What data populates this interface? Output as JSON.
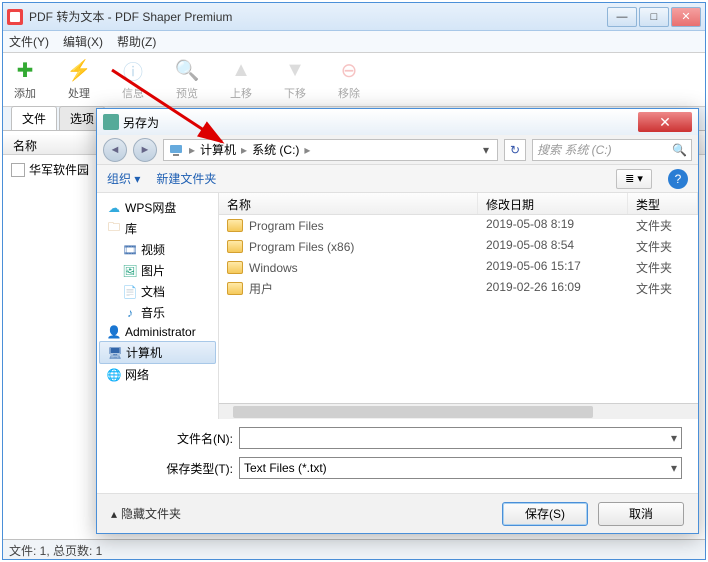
{
  "main": {
    "title": "PDF 转为文本 - PDF Shaper Premium",
    "menu": {
      "file": "文件(Y)",
      "edit": "编辑(X)",
      "help": "帮助(Z)"
    },
    "tools": {
      "add": "添加",
      "process": "处理",
      "info": "信息",
      "preview": "预览",
      "up": "上移",
      "down": "下移",
      "remove": "移除"
    },
    "tabs": {
      "files": "文件",
      "options": "选项"
    },
    "list_header": "名称",
    "list_item": "华军软件园",
    "status": "文件: 1, 总页数: 1"
  },
  "dialog": {
    "title": "另存为",
    "breadcrumb": {
      "computer": "计算机",
      "drive": "系统 (C:)"
    },
    "search_placeholder": "搜索 系统 (C:)",
    "toolbar": {
      "organize": "组织",
      "newfolder": "新建文件夹"
    },
    "tree": {
      "wps": "WPS网盘",
      "lib": "库",
      "video": "视频",
      "pic": "图片",
      "doc": "文档",
      "music": "音乐",
      "admin": "Administrator",
      "computer": "计算机",
      "network": "网络"
    },
    "cols": {
      "name": "名称",
      "date": "修改日期",
      "type": "类型"
    },
    "rows": [
      {
        "name": "Program Files",
        "date": "2019-05-08 8:19",
        "type": "文件夹"
      },
      {
        "name": "Program Files (x86)",
        "date": "2019-05-08 8:54",
        "type": "文件夹"
      },
      {
        "name": "Windows",
        "date": "2019-05-06 15:17",
        "type": "文件夹"
      },
      {
        "name": "用户",
        "date": "2019-02-26 16:09",
        "type": "文件夹"
      }
    ],
    "form": {
      "filename_label": "文件名(N):",
      "filename_value": "",
      "type_label": "保存类型(T):",
      "type_value": "Text Files (*.txt)"
    },
    "footer": {
      "hide": "隐藏文件夹",
      "save": "保存(S)",
      "cancel": "取消"
    }
  }
}
